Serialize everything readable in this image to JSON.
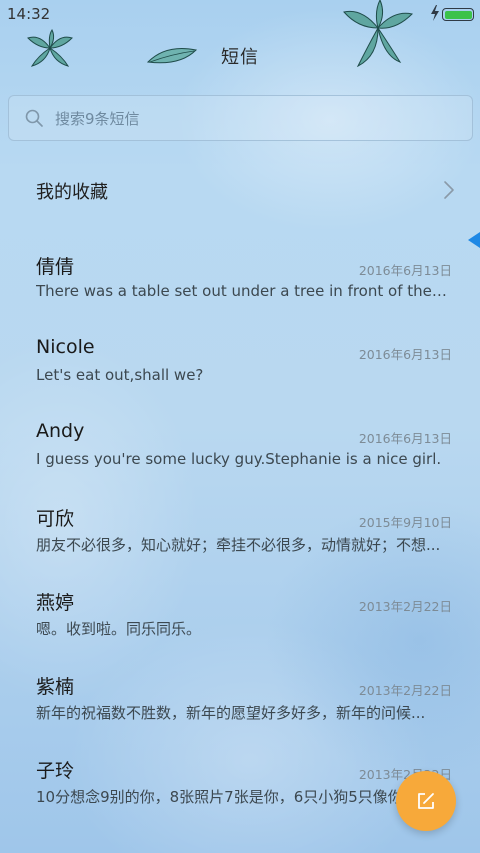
{
  "status_bar": {
    "time": "14:32",
    "battery_level": 1.0,
    "charging": true,
    "colors": {
      "battery": "#3cc24a"
    }
  },
  "header": {
    "title": "短信"
  },
  "search": {
    "placeholder": "搜索9条短信",
    "icon": "search-icon"
  },
  "favorites": {
    "label": "我的收藏",
    "icon": "chevron-right-icon"
  },
  "conversations": [
    {
      "name": "倩倩",
      "date": "2016年6月13日",
      "preview": "There was a table set out under a tree in front of the ho.."
    },
    {
      "name": "Nicole",
      "date": "2016年6月13日",
      "preview": "Let's eat out,shall we?"
    },
    {
      "name": "Andy",
      "date": "2016年6月13日",
      "preview": "I guess you're some lucky guy.Stephanie is a nice girl."
    },
    {
      "name": "可欣",
      "date": "2015年9月10日",
      "preview": "朋友不必很多，知心就好；牵挂不必很多，动情就好；不想..."
    },
    {
      "name": "燕婷",
      "date": "2013年2月22日",
      "preview": "嗯。收到啦。同乐同乐。"
    },
    {
      "name": "紫楠",
      "date": "2013年2月22日",
      "preview": "新年的祝福数不胜数，新年的愿望好多好多，新年的问候..."
    },
    {
      "name": "子玲",
      "date": "2013年2月22日",
      "preview": "10分想念9别的你，8张照片7张是你，6只小狗5只像你"
    }
  ],
  "compose": {
    "icon": "edit-icon",
    "color": "#f7a93a"
  },
  "colors": {
    "accent": "#1e88e5",
    "background": "#b8d9f2"
  }
}
